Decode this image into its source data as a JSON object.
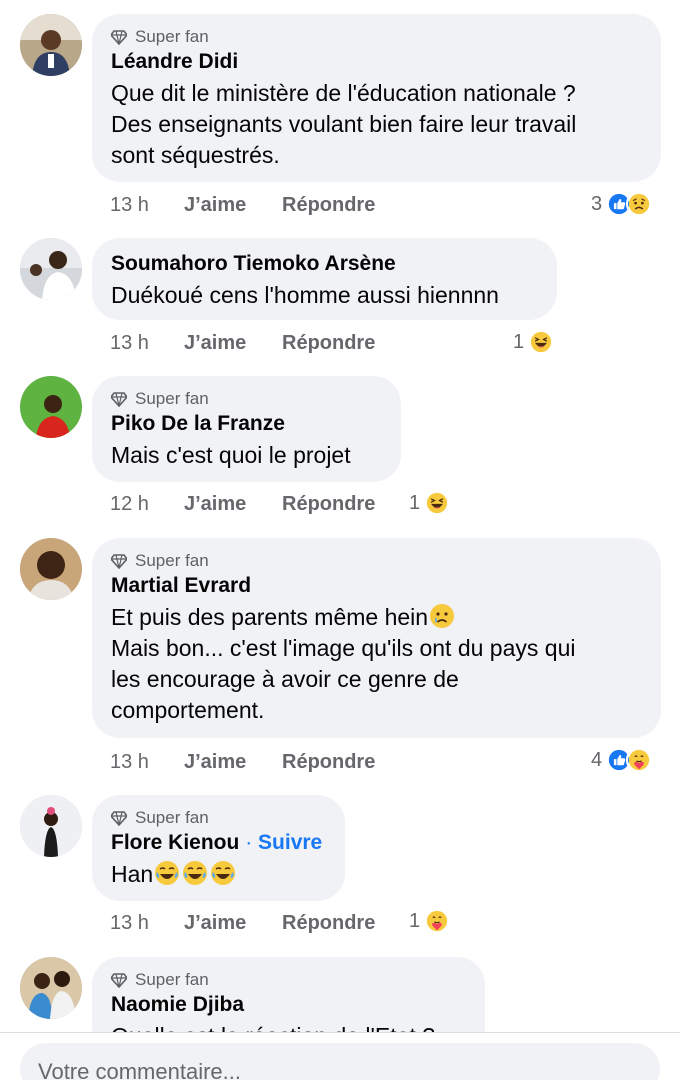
{
  "comments": [
    {
      "badge": "Super fan",
      "author": "Léandre Didi",
      "lines": [
        "Que dit le ministère de l'éducation nationale ?",
        "Des enseignants voulant bien faire leur travail",
        "sont séquestrés."
      ],
      "time": "13 h",
      "like": "J’aime",
      "reply": "Répondre",
      "reaction_count": "3",
      "reactions": [
        "like-icon",
        "sad-icon"
      ]
    },
    {
      "author": "Soumahoro Tiemoko Arsène",
      "lines": [
        "Duékoué cens l'homme aussi hiennnn"
      ],
      "time": "13 h",
      "like": "J’aime",
      "reply": "Répondre",
      "reaction_count": "1",
      "reactions": [
        "haha-icon"
      ]
    },
    {
      "badge": "Super fan",
      "author": "Piko De la Franze",
      "lines": [
        "Mais c'est quoi le projet"
      ],
      "time": "12 h",
      "like": "J’aime",
      "reply": "Répondre",
      "reaction_count": "1",
      "reactions": [
        "haha-icon"
      ]
    },
    {
      "badge": "Super fan",
      "author": "Martial Evrard",
      "lines": [
        "Et puis des parents même hein",
        "Mais bon... c'est l'image qu'ils ont du pays qui",
        "les encourage à avoir ce genre de",
        "comportement."
      ],
      "time": "13 h",
      "like": "J’aime",
      "reply": "Répondre",
      "reaction_count": "4",
      "reactions": [
        "like-icon",
        "care-icon"
      ]
    },
    {
      "badge": "Super fan",
      "author": "Flore Kienou",
      "follow_sep": "·",
      "follow": "Suivre",
      "lines": [
        "Han"
      ],
      "time": "13 h",
      "like": "J’aime",
      "reply": "Répondre",
      "reaction_count": "1",
      "reactions": [
        "care-icon"
      ]
    },
    {
      "badge": "Super fan",
      "author": "Naomie Djiba",
      "lines": [
        "Quelle est la réaction de l'Etat ?"
      ]
    }
  ],
  "composer": {
    "placeholder": "Votre commentaire..."
  },
  "colors": {
    "bubble": "#f0f2f5",
    "link_blue": "#1877f2",
    "muted": "#65676b"
  }
}
